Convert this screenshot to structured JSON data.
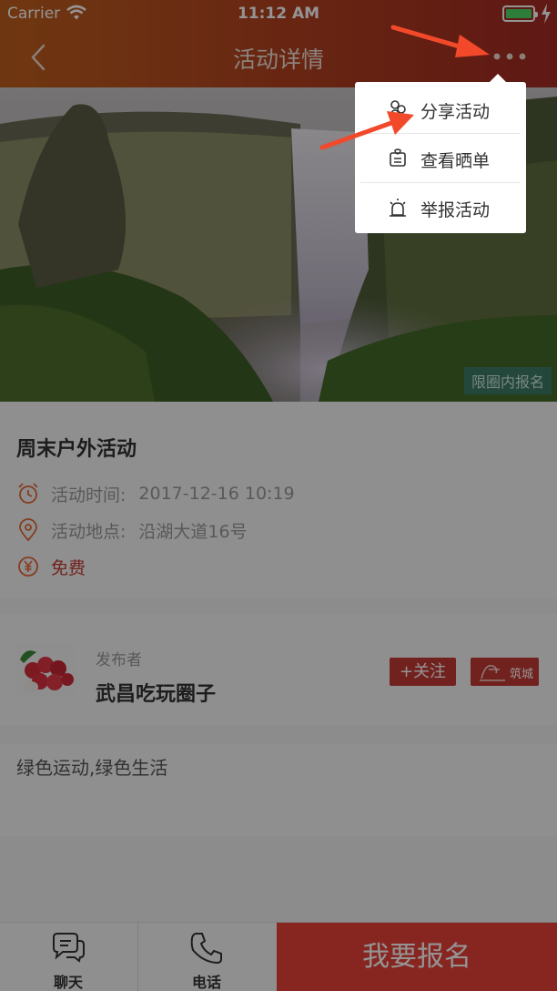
{
  "status_bar": {
    "carrier": "Carrier",
    "time": "11:12 AM"
  },
  "nav": {
    "title": "活动详情",
    "back_icon": "chevron-left-icon",
    "more_icon": "more-dots-icon"
  },
  "hero": {
    "badge": "限圈内报名"
  },
  "activity": {
    "title": "周末户外活动",
    "time_label": "活动时间:",
    "time_value": "2017-12-16 10:19",
    "location_label": "活动地点:",
    "location_value": "沿湖大道16号",
    "price": "免费"
  },
  "publisher": {
    "label": "发布者",
    "name": "武昌吃玩圈子",
    "follow_label": "+关注",
    "brand_label": "筑城"
  },
  "description": "绿色运动,绿色生活",
  "bottom_bar": {
    "chat_label": "聊天",
    "phone_label": "电话",
    "signup_label": "我要报名"
  },
  "popup_menu": {
    "items": [
      {
        "label": "分享活动",
        "icon": "share-icon"
      },
      {
        "label": "查看晒单",
        "icon": "order-list-icon"
      },
      {
        "label": "举报活动",
        "icon": "alarm-icon"
      }
    ]
  },
  "colors": {
    "brand_red": "#e9423a",
    "header_start": "#c0601e",
    "header_end": "#a42a24",
    "annotation_arrow": "#f2492b"
  }
}
